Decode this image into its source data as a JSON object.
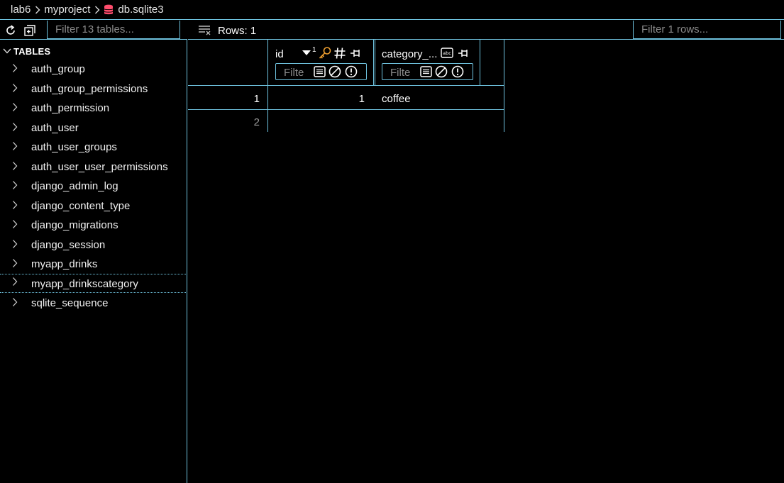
{
  "breadcrumb": {
    "items": [
      "lab6",
      "myproject",
      "db.sqlite3"
    ]
  },
  "left_toolbar": {
    "refresh_icon": "refresh-icon",
    "add_icon": "add-square-icon",
    "filter_placeholder": "Filter 13 tables..."
  },
  "sidebar": {
    "section_label": "TABLES",
    "items": [
      {
        "label": "auth_group"
      },
      {
        "label": "auth_group_permissions"
      },
      {
        "label": "auth_permission"
      },
      {
        "label": "auth_user"
      },
      {
        "label": "auth_user_groups"
      },
      {
        "label": "auth_user_user_permissions"
      },
      {
        "label": "django_admin_log"
      },
      {
        "label": "django_content_type"
      },
      {
        "label": "django_migrations"
      },
      {
        "label": "django_session"
      },
      {
        "label": "myapp_drinks"
      },
      {
        "label": "myapp_drinkscategory",
        "selected": true
      },
      {
        "label": "sqlite_sequence"
      }
    ]
  },
  "right_toolbar": {
    "rows_label": "Rows: 1",
    "filter_placeholder": "Filter 1 rows..."
  },
  "grid": {
    "columns": [
      {
        "name": "id",
        "sort_order": "1",
        "filter_placeholder": "Filte"
      },
      {
        "name": "category_...",
        "filter_placeholder": "Filte"
      }
    ],
    "rows": [
      {
        "rownum": "1",
        "cells": [
          "1",
          "coffee"
        ]
      },
      {
        "rownum": "2",
        "cells": [
          "",
          ""
        ]
      }
    ]
  },
  "colors": {
    "border": "#6fc3df",
    "accent_orange": "#f0a030",
    "db_icon": "#ff4d6d",
    "background": "#000000"
  }
}
